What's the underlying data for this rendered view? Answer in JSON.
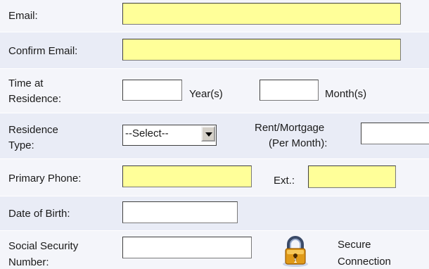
{
  "form": {
    "email_label": "Email:",
    "confirm_email_label": "Confirm Email:",
    "time_at_residence_label_1": "Time at",
    "time_at_residence_label_2": "Residence:",
    "years_suffix": "Year(s)",
    "months_suffix": "Month(s)",
    "residence_type_label_1": "Residence",
    "residence_type_label_2": "Type:",
    "residence_type_selected": "--Select--",
    "rent_mortgage_label_1": "Rent/Mortgage",
    "rent_mortgage_label_2": "(Per Month):",
    "primary_phone_label": "Primary Phone:",
    "ext_label": "Ext.:",
    "dob_label": "Date of Birth:",
    "ssn_label_1": "Social Security",
    "ssn_label_2": "Number:"
  },
  "secure": {
    "line1": "Secure",
    "line2": "Connection",
    "icon": "padlock-icon"
  },
  "colors": {
    "required_field": "#ffff99",
    "background": "#eef0f7"
  }
}
